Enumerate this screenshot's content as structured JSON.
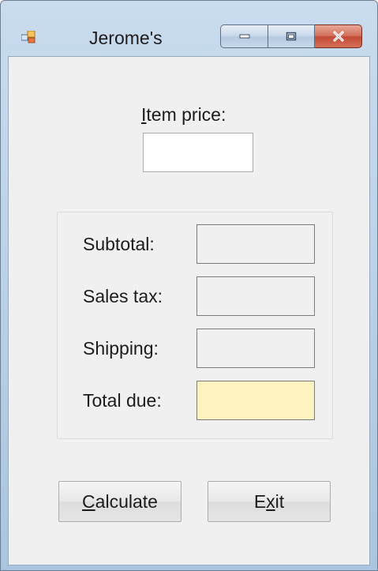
{
  "window": {
    "title": "Jerome's",
    "icon": "app-icon"
  },
  "form": {
    "item_price_label": {
      "mnemonic": "I",
      "rest": "tem price:"
    },
    "item_price_value": "",
    "fields": [
      {
        "label": "Subtotal:",
        "value": ""
      },
      {
        "label": "Sales tax:",
        "value": ""
      },
      {
        "label": "Shipping:",
        "value": ""
      },
      {
        "label": "Total due:",
        "value": ""
      }
    ],
    "calculate_button": {
      "mnemonic": "C",
      "rest": "alculate"
    },
    "exit_button": {
      "before": "E",
      "mnemonic": "x",
      "after": "it"
    }
  },
  "colors": {
    "total_due_background": "#fff3c0",
    "client_background": "#f0f0f0",
    "close_button": "#c24a35"
  }
}
